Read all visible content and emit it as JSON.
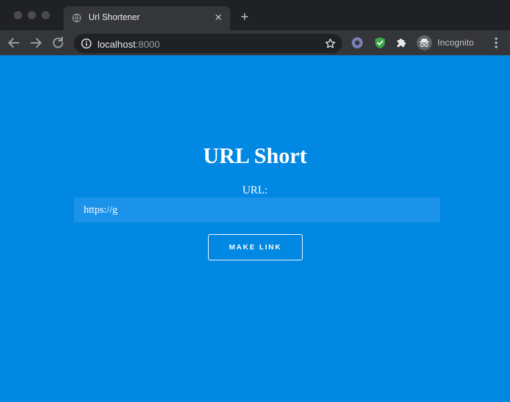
{
  "browser": {
    "tab": {
      "title": "Url Shortener"
    },
    "address": {
      "host": "localhost",
      "port": ":8000"
    },
    "profile": {
      "label": "Incognito"
    }
  },
  "page": {
    "title": "URL Short",
    "url_label": "URL:",
    "url_input": {
      "value": "https://g",
      "placeholder": ""
    },
    "submit_label": "MAKE LINK"
  },
  "colors": {
    "page_background": "#0088e2",
    "input_background": "#1b93ea",
    "chrome_dark": "#202124",
    "toolbar": "#35363a"
  }
}
